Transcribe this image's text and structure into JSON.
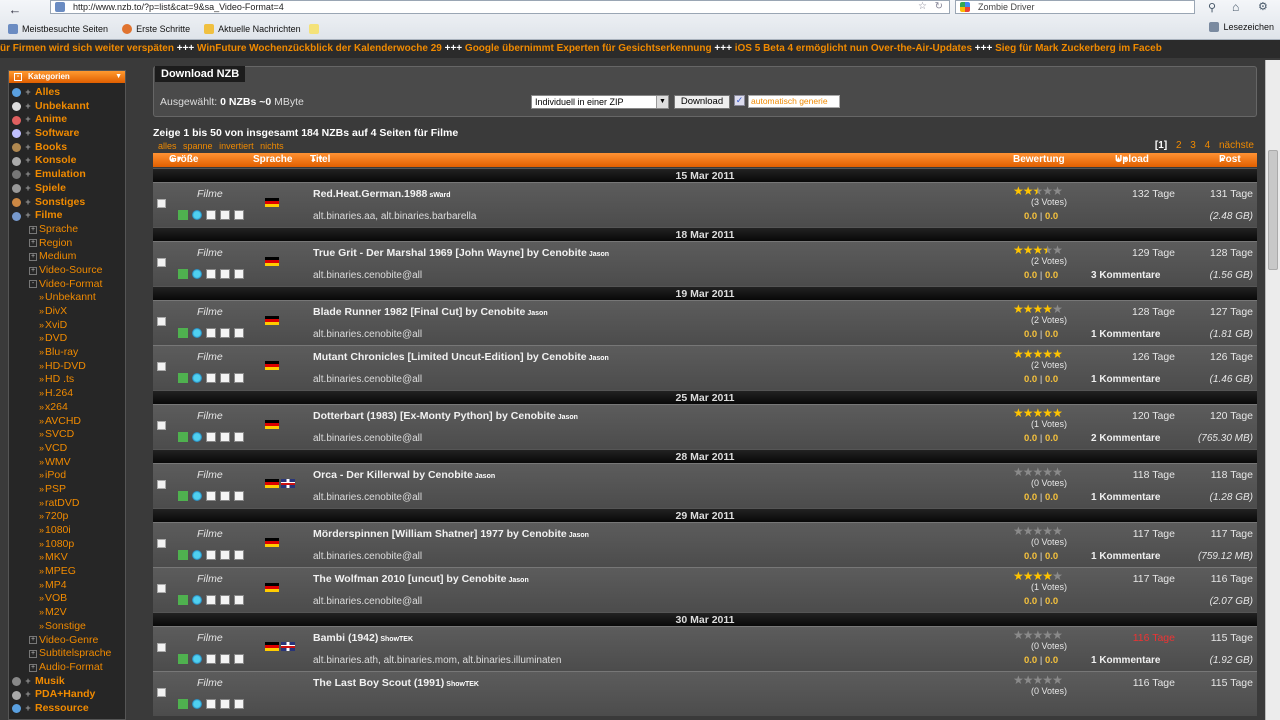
{
  "browser": {
    "url": "http://www.nzb.to/?p=list&cat=9&sa_Video-Format=4",
    "search_text": "Zombie Driver",
    "bookmarks": [
      "Meistbesuchte Seiten",
      "Erste Schritte",
      "Aktuelle Nachrichten"
    ],
    "lesezeichen": "Lesezeichen"
  },
  "ticker": {
    "items": [
      "ür Firmen wird sich weiter verspäten",
      "WinFuture Wochenzückblick der Kalenderwoche 29",
      "Google übernimmt Experten für Gesichtserkennung",
      "iOS 5 Beta 4 ermöglicht nun Over-the-Air-Updates",
      "Sieg für Mark Zuckerberg im Faceb"
    ],
    "sep": "+++"
  },
  "sidebar": {
    "title": "Kategorien",
    "items": [
      {
        "label": "Alles",
        "level": 0,
        "color": "#5aa0e0"
      },
      {
        "label": "Unbekannt",
        "level": 0,
        "color": "#dddddd"
      },
      {
        "label": "Anime",
        "level": 0,
        "color": "#e06060"
      },
      {
        "label": "Software",
        "level": 0,
        "color": "#c0c0ff"
      },
      {
        "label": "Books",
        "level": 0,
        "color": "#b08850"
      },
      {
        "label": "Konsole",
        "level": 0,
        "color": "#aaaaaa"
      },
      {
        "label": "Emulation",
        "level": 0,
        "color": "#777777"
      },
      {
        "label": "Spiele",
        "level": 0,
        "color": "#999999"
      },
      {
        "label": "Sonstiges",
        "level": 0,
        "color": "#cc8844"
      },
      {
        "label": "Filme",
        "level": 0,
        "color": "#7799cc"
      },
      {
        "label": "Sprache",
        "level": 1
      },
      {
        "label": "Region",
        "level": 1
      },
      {
        "label": "Medium",
        "level": 1
      },
      {
        "label": "Video-Source",
        "level": 1
      },
      {
        "label": "Video-Format",
        "level": 1,
        "open": true
      },
      {
        "label": "Unbekannt",
        "level": 2
      },
      {
        "label": "DivX",
        "level": 2
      },
      {
        "label": "XviD",
        "level": 2
      },
      {
        "label": "DVD",
        "level": 2
      },
      {
        "label": "Blu-ray",
        "level": 2
      },
      {
        "label": "HD-DVD",
        "level": 2
      },
      {
        "label": "HD .ts",
        "level": 2
      },
      {
        "label": "H.264",
        "level": 2
      },
      {
        "label": "x264",
        "level": 2
      },
      {
        "label": "AVCHD",
        "level": 2
      },
      {
        "label": "SVCD",
        "level": 2
      },
      {
        "label": "VCD",
        "level": 2
      },
      {
        "label": "WMV",
        "level": 2
      },
      {
        "label": "iPod",
        "level": 2
      },
      {
        "label": "PSP",
        "level": 2
      },
      {
        "label": "ratDVD",
        "level": 2
      },
      {
        "label": "720p",
        "level": 2
      },
      {
        "label": "1080i",
        "level": 2
      },
      {
        "label": "1080p",
        "level": 2
      },
      {
        "label": "MKV",
        "level": 2
      },
      {
        "label": "MPEG",
        "level": 2
      },
      {
        "label": "MP4",
        "level": 2
      },
      {
        "label": "VOB",
        "level": 2
      },
      {
        "label": "M2V",
        "level": 2
      },
      {
        "label": "Sonstige",
        "level": 2
      },
      {
        "label": "Video-Genre",
        "level": 1
      },
      {
        "label": "Subtitelsprache",
        "level": 1
      },
      {
        "label": "Audio-Format",
        "level": 1
      },
      {
        "label": "Musik",
        "level": 0,
        "color": "#888888"
      },
      {
        "label": "PDA+Handy",
        "level": 0,
        "color": "#aaaaaa"
      },
      {
        "label": "Ressource",
        "level": 0,
        "color": "#5aa0e0"
      }
    ]
  },
  "download": {
    "title": "Download NZB",
    "selected_prefix": "Ausgewählt:",
    "selected_count": "0",
    "selected_mid": "NZBs ~",
    "selected_size": "0",
    "selected_unit": "MByte",
    "zip_option": "Individuell in einer ZIP",
    "button": "Download",
    "auto_placeholder": "automatisch generie"
  },
  "summary": "Zeige 1 bis 50 von insgesamt 184 NZBs auf 4 Seiten für Filme",
  "select_links": [
    "alles",
    "spanne",
    "invertiert",
    "nichts"
  ],
  "pager": {
    "current": "[1]",
    "pages": [
      "2",
      "3",
      "4"
    ],
    "next": "nächste"
  },
  "columns": {
    "size": "Größe",
    "lang": "Sprache",
    "title": "Titel",
    "rating": "Bewertung",
    "upload": "Upload",
    "post": "Post"
  },
  "rows": [
    {
      "type": "date",
      "label": "15 Mar 2011"
    },
    {
      "type": "item",
      "cat": "Filme",
      "title": "Red.Heat.German.1988",
      "uploader": "sWard",
      "groups": "alt.binaries.aa, alt.binaries.barbarella",
      "stars": 2.5,
      "votes": "(3 Votes)",
      "score_a": "0.0",
      "score_b": "0.0",
      "age": "132 Tage",
      "post": "131 Tage",
      "comments": "",
      "size": "(2.48 GB)",
      "flags": [
        "de"
      ]
    },
    {
      "type": "date",
      "label": "18 Mar 2011"
    },
    {
      "type": "item",
      "cat": "Filme",
      "title": "True Grit - Der Marshal 1969 [John Wayne] by Cenobite",
      "uploader": "Jason",
      "groups": "alt.binaries.cenobite@all",
      "stars": 3.5,
      "votes": "(2 Votes)",
      "score_a": "0.0",
      "score_b": "0.0",
      "age": "129 Tage",
      "post": "128 Tage",
      "comments": "3 Kommentare",
      "size": "(1.56 GB)",
      "flags": [
        "de"
      ]
    },
    {
      "type": "date",
      "label": "19 Mar 2011"
    },
    {
      "type": "item",
      "cat": "Filme",
      "title": "Blade Runner 1982 [Final Cut] by Cenobite",
      "uploader": "Jason",
      "groups": "alt.binaries.cenobite@all",
      "stars": 4,
      "votes": "(2 Votes)",
      "score_a": "0.0",
      "score_b": "0.0",
      "age": "128 Tage",
      "post": "127 Tage",
      "comments": "1 Kommentare",
      "size": "(1.81 GB)",
      "flags": [
        "de"
      ]
    },
    {
      "type": "item",
      "cat": "Filme",
      "title": "Mutant Chronicles [Limited Uncut-Edition] by Cenobite",
      "uploader": "Jason",
      "groups": "alt.binaries.cenobite@all",
      "stars": 5,
      "votes": "(2 Votes)",
      "score_a": "0.0",
      "score_b": "0.0",
      "age": "126 Tage",
      "post": "126 Tage",
      "comments": "1 Kommentare",
      "size": "(1.46 GB)",
      "flags": [
        "de"
      ]
    },
    {
      "type": "date",
      "label": "25 Mar 2011"
    },
    {
      "type": "item",
      "cat": "Filme",
      "title": "Dotterbart (1983) [Ex-Monty Python] by Cenobite",
      "uploader": "Jason",
      "groups": "alt.binaries.cenobite@all",
      "stars": 5,
      "votes": "(1 Votes)",
      "score_a": "0.0",
      "score_b": "0.0",
      "age": "120 Tage",
      "post": "120 Tage",
      "comments": "2 Kommentare",
      "size": "(765.30 MB)",
      "flags": [
        "de"
      ]
    },
    {
      "type": "date",
      "label": "28 Mar 2011"
    },
    {
      "type": "item",
      "cat": "Filme",
      "title": "Orca - Der Killerwal by Cenobite",
      "uploader": "Jason",
      "groups": "alt.binaries.cenobite@all",
      "stars": 0,
      "votes": "(0 Votes)",
      "score_a": "0.0",
      "score_b": "0.0",
      "age": "118 Tage",
      "post": "118 Tage",
      "comments": "1 Kommentare",
      "size": "(1.28 GB)",
      "flags": [
        "de",
        "uk"
      ]
    },
    {
      "type": "date",
      "label": "29 Mar 2011"
    },
    {
      "type": "item",
      "cat": "Filme",
      "title": "Mörderspinnen [William Shatner] 1977 by Cenobite",
      "uploader": "Jason",
      "groups": "alt.binaries.cenobite@all",
      "stars": 0,
      "votes": "(0 Votes)",
      "score_a": "0.0",
      "score_b": "0.0",
      "age": "117 Tage",
      "post": "117 Tage",
      "comments": "1 Kommentare",
      "size": "(759.12 MB)",
      "flags": [
        "de"
      ]
    },
    {
      "type": "item",
      "cat": "Filme",
      "title": "The Wolfman 2010 [uncut] by Cenobite",
      "uploader": "Jason",
      "groups": "alt.binaries.cenobite@all",
      "stars": 4,
      "votes": "(1 Votes)",
      "score_a": "0.0",
      "score_b": "0.0",
      "age": "117 Tage",
      "post": "116 Tage",
      "comments": "",
      "size": "(2.07 GB)",
      "flags": [
        "de"
      ]
    },
    {
      "type": "date",
      "label": "30 Mar 2011"
    },
    {
      "type": "item",
      "cat": "Filme",
      "title": "Bambi (1942)",
      "uploader": "ShowTEK",
      "groups": "alt.binaries.ath, alt.binaries.mom, alt.binaries.illuminaten",
      "stars": 0,
      "votes": "(0 Votes)",
      "score_a": "0.0",
      "score_b": "0.0",
      "age": "116 Tage",
      "age_red": true,
      "post": "115 Tage",
      "comments": "1 Kommentare",
      "size": "(1.92 GB)",
      "flags": [
        "de",
        "uk"
      ]
    },
    {
      "type": "item",
      "cat": "Filme",
      "title": "The Last Boy Scout (1991)",
      "uploader": "ShowTEK",
      "groups": "",
      "stars": 0,
      "votes": "(0 Votes)",
      "score_a": "",
      "score_b": "",
      "age": "116 Tage",
      "post": "115 Tage",
      "comments": "",
      "size": "",
      "flags": []
    }
  ],
  "colors": {
    "accent": "#f08a00",
    "star": "#ffc400"
  }
}
